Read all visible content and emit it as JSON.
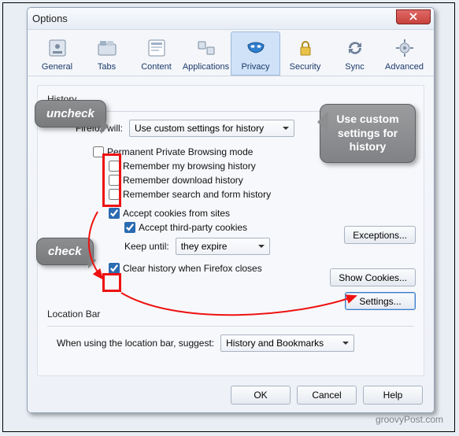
{
  "window": {
    "title": "Options"
  },
  "categories": [
    {
      "key": "general",
      "label": "General"
    },
    {
      "key": "tabs",
      "label": "Tabs"
    },
    {
      "key": "content",
      "label": "Content"
    },
    {
      "key": "applications",
      "label": "Applications"
    },
    {
      "key": "privacy",
      "label": "Privacy",
      "selected": true
    },
    {
      "key": "security",
      "label": "Security"
    },
    {
      "key": "sync",
      "label": "Sync"
    },
    {
      "key": "advanced",
      "label": "Advanced"
    }
  ],
  "history": {
    "group_label": "History",
    "will_label": "Firefox will:",
    "will_value": "Use custom settings for history",
    "permanent_pb": {
      "label": "Permanent Private Browsing mode",
      "checked": false
    },
    "remember_browsing": {
      "label": "Remember my browsing history",
      "checked": false
    },
    "remember_download": {
      "label": "Remember download history",
      "checked": false
    },
    "remember_forms": {
      "label": "Remember search and form history",
      "checked": false
    },
    "accept_cookies": {
      "label": "Accept cookies from sites",
      "checked": true
    },
    "accept_third_party": {
      "label": "Accept third-party cookies",
      "checked": true
    },
    "keep_until": {
      "label": "Keep until:",
      "value": "they expire"
    },
    "clear_on_close": {
      "label": "Clear history when Firefox closes",
      "checked": true
    },
    "buttons": {
      "exceptions": "Exceptions...",
      "show_cookies": "Show Cookies...",
      "settings": "Settings..."
    }
  },
  "locationbar": {
    "group_label": "Location Bar",
    "suggest_label": "When using the location bar, suggest:",
    "suggest_value": "History and Bookmarks"
  },
  "dialog_buttons": {
    "ok": "OK",
    "cancel": "Cancel",
    "help": "Help"
  },
  "annotations": {
    "uncheck": "uncheck",
    "check": "check",
    "use_custom": "Use custom settings for history"
  },
  "watermark": "groovyPost.com"
}
